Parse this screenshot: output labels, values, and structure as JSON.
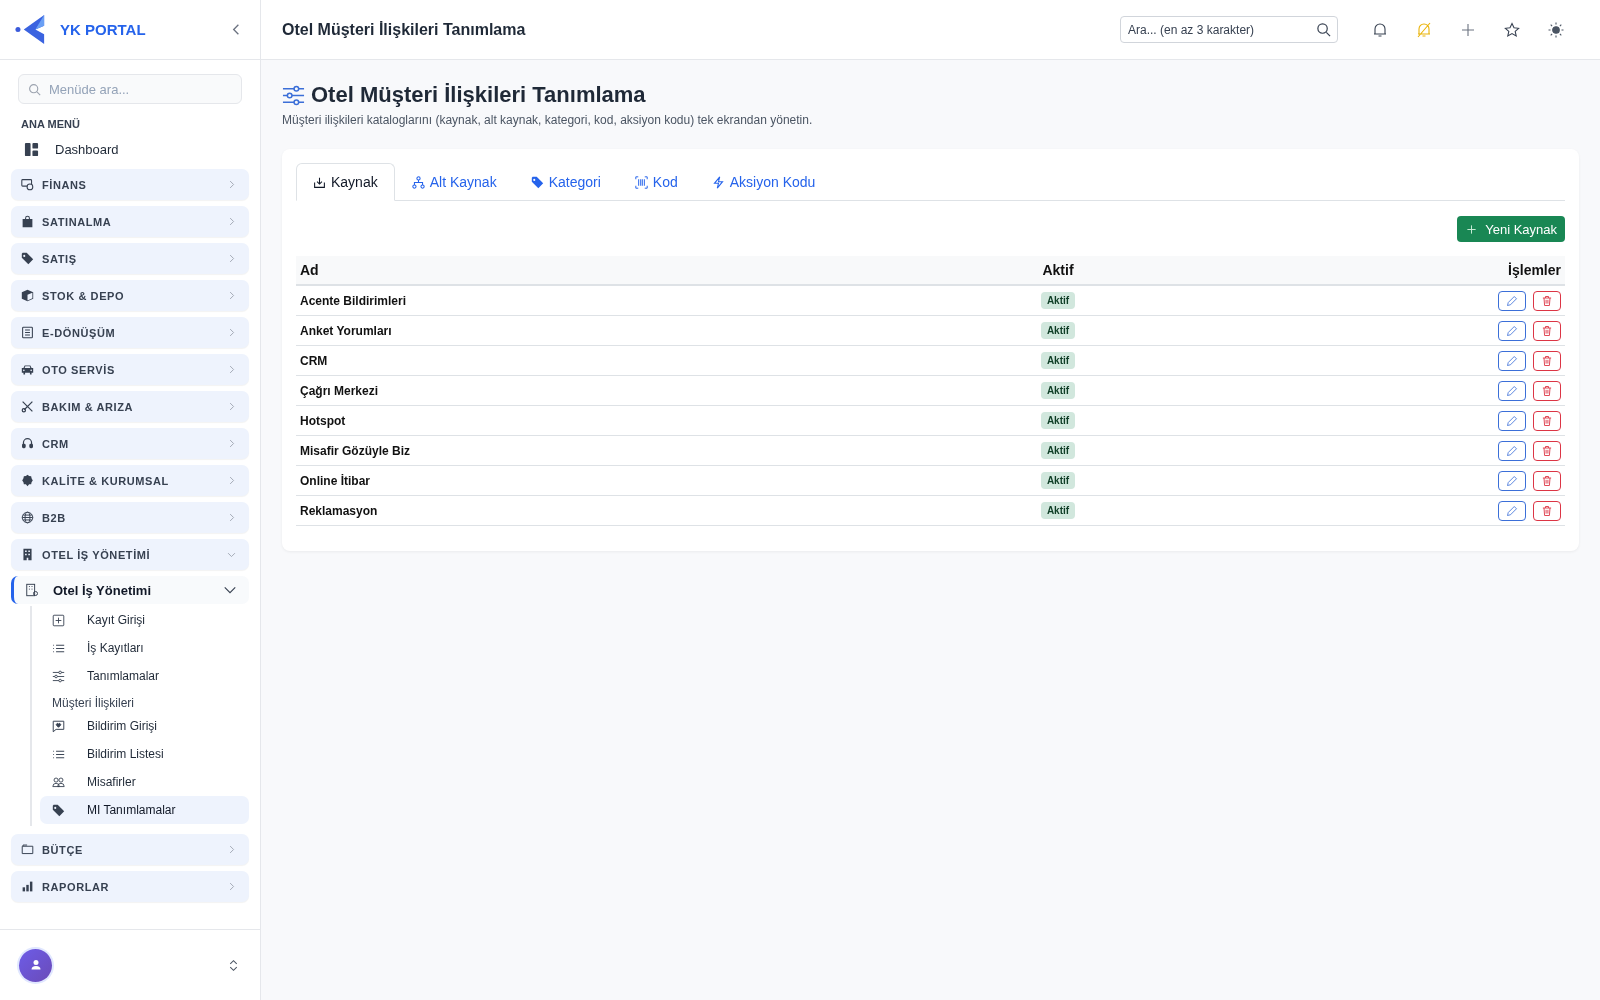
{
  "sidebar": {
    "brand": "YK PORTAL",
    "search": {
      "placeholder": "Menüde ara..."
    },
    "section_title": "ANA MENÜ",
    "menu": [
      {
        "kind": "link",
        "label": "Dashboard",
        "selected": false
      },
      {
        "kind": "group",
        "label": "FİNANS",
        "expanded": false
      },
      {
        "kind": "group",
        "label": "SATINALMA",
        "expanded": false
      },
      {
        "kind": "group",
        "label": "SATIŞ",
        "expanded": false
      },
      {
        "kind": "group",
        "label": "STOK & DEPO",
        "expanded": false
      },
      {
        "kind": "group",
        "label": "E-DÖNÜŞÜM",
        "expanded": false
      },
      {
        "kind": "group",
        "label": "OTO SERVİS",
        "expanded": false
      },
      {
        "kind": "group",
        "label": "BAKIM & ARIZA",
        "expanded": false
      },
      {
        "kind": "group",
        "label": "CRM",
        "expanded": false
      },
      {
        "kind": "group",
        "label": "KALİTE & KURUMSAL",
        "expanded": false
      },
      {
        "kind": "group",
        "label": "B2B",
        "expanded": false
      },
      {
        "kind": "group",
        "label": "OTEL İŞ YÖNETİMİ",
        "expanded": true,
        "children": [
          {
            "label": "Otel İş Yönetimi",
            "expanded": true,
            "children": [
              {
                "kind": "link",
                "label": "Kayıt Girişi",
                "selected": false
              },
              {
                "kind": "link",
                "label": "İş Kayıtları",
                "selected": false
              },
              {
                "kind": "link",
                "label": "Tanımlamalar",
                "selected": false
              },
              {
                "kind": "heading",
                "label": "Müşteri İlişkileri"
              },
              {
                "kind": "link",
                "label": "Bildirim Girişi",
                "selected": false
              },
              {
                "kind": "link",
                "label": "Bildirim Listesi",
                "selected": false
              },
              {
                "kind": "link",
                "label": "Misafirler",
                "selected": false
              },
              {
                "kind": "link",
                "label": "MI Tanımlamalar",
                "selected": true
              }
            ]
          }
        ]
      },
      {
        "kind": "group",
        "label": "BÜTÇE",
        "expanded": false
      },
      {
        "kind": "group",
        "label": "RAPORLAR",
        "expanded": false
      }
    ]
  },
  "header": {
    "title": "Otel Müşteri İlişkileri Tanımlama",
    "search": {
      "placeholder": "Ara... (en az 3 karakter)"
    }
  },
  "page": {
    "title": "Otel Müşteri İlişkileri Tanımlama",
    "subtitle": "Müşteri ilişkileri kataloglarını (kaynak, alt kaynak, kategori, kod, aksiyon kodu) tek ekrandan yönetin."
  },
  "tabs": [
    {
      "label": "Kaynak",
      "selected": true
    },
    {
      "label": "Alt Kaynak",
      "selected": false
    },
    {
      "label": "Kategori",
      "selected": false
    },
    {
      "label": "Kod",
      "selected": false
    },
    {
      "label": "Aksiyon Kodu",
      "selected": false
    }
  ],
  "new_button": "Yeni Kaynak",
  "table": {
    "columns": [
      "Ad",
      "Aktif",
      "İşlemler"
    ],
    "rows": [
      {
        "name": "Acente Bildirimleri",
        "status": "Aktif",
        "active": true
      },
      {
        "name": "Anket Yorumları",
        "status": "Aktif",
        "active": true
      },
      {
        "name": "CRM",
        "status": "Aktif",
        "active": true
      },
      {
        "name": "Çağrı Merkezi",
        "status": "Aktif",
        "active": true
      },
      {
        "name": "Hotspot",
        "status": "Aktif",
        "active": true
      },
      {
        "name": "Misafir Gözüyle Biz",
        "status": "Aktif",
        "active": true
      },
      {
        "name": "Online İtibar",
        "status": "Aktif",
        "active": true
      },
      {
        "name": "Reklamasyon",
        "status": "Aktif",
        "active": true
      }
    ]
  }
}
